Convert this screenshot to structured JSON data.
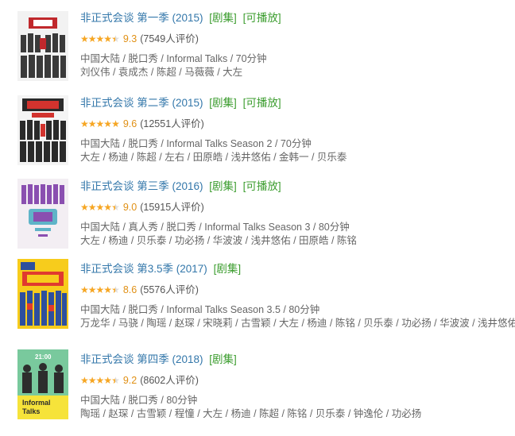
{
  "shows": [
    {
      "title": "非正式会谈 第一季 (2015)",
      "tags": [
        "[剧集]",
        "[可播放]"
      ],
      "stars": 4.5,
      "score": "9.3",
      "count": "(7549人评价)",
      "meta": "中国大陆 / 脱口秀 / Informal Talks / 70分钟",
      "cast": "刘仪伟 / 袁成杰 / 陈超 / 马薇薇 / 大左",
      "poster_colors": [
        "#f2f2f2",
        "#c0282c",
        "#3a3a3a"
      ]
    },
    {
      "title": "非正式会谈 第二季 (2015)",
      "tags": [
        "[剧集]",
        "[可播放]"
      ],
      "stars": 5,
      "score": "9.6",
      "count": "(12551人评价)",
      "meta": "中国大陆 / 脱口秀 / Informal Talks Season 2 / 70分钟",
      "cast": "大左 / 杨迪 / 陈超 / 左右 / 田原皓 / 浅井悠佑 / 金韩一 / 贝乐泰",
      "poster_colors": [
        "#f4f4f4",
        "#d2332e",
        "#2a2a2a"
      ]
    },
    {
      "title": "非正式会谈 第三季 (2016)",
      "tags": [
        "[剧集]",
        "[可播放]"
      ],
      "stars": 4.5,
      "score": "9.0",
      "count": "(15915人评价)",
      "meta": "中国大陆 / 真人秀 / 脱口秀 / Informal Talks Season 3 / 80分钟",
      "cast": "大左 / 杨迪 / 贝乐泰 / 功必扬 / 华波波 / 浅井悠佑 / 田原皓 / 陈铭",
      "poster_colors": [
        "#f3eef3",
        "#8a4fb0",
        "#5fb4c8"
      ]
    },
    {
      "title": "非正式会谈 第3.5季 (2017)",
      "tags": [
        "[剧集]"
      ],
      "stars": 4.5,
      "score": "8.6",
      "count": "(5576人评价)",
      "meta": "中国大陆 / 脱口秀 / Informal Talks Season 3.5 / 80分钟",
      "cast": "万龙华 / 马骁 / 陶瑶 / 赵琛 / 宋晓莉 / 古雪颖 / 大左 / 杨迪 / 陈铭 / 贝乐泰 / 功必扬 / 华波波 / 浅井悠佑",
      "poster_colors": [
        "#f7cc1c",
        "#e03a2f",
        "#2d4f9e"
      ]
    },
    {
      "title": "非正式会谈 第四季 (2018)",
      "tags": [
        "[剧集]"
      ],
      "stars": 4.5,
      "score": "9.2",
      "count": "(8602人评价)",
      "meta": "中国大陆 / 脱口秀 / 80分钟",
      "cast": "陶瑶 / 赵琛 / 古雪颖 / 程憧 / 大左 / 杨迪 / 陈超 / 陈铭 / 贝乐泰 / 钟逸伦 / 功必扬",
      "poster_colors": [
        "#79c99d",
        "#2d2d2d",
        "#f6e33a"
      ],
      "poster_text": [
        "21:00",
        "Informal",
        "Talks"
      ]
    }
  ]
}
